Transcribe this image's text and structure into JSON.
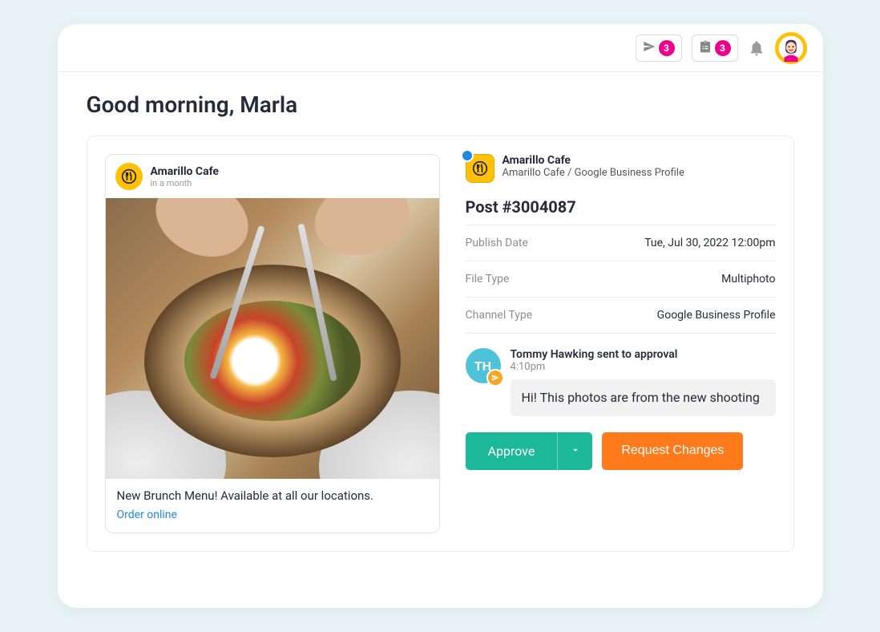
{
  "topbar": {
    "send_badge": "3",
    "clipboard_badge": "3"
  },
  "greeting": "Good morning, Marla",
  "preview": {
    "account": "Amarillo Cafe",
    "timing": "in a month",
    "caption": "New Brunch Menu! Available at all our locations.",
    "link": "Order online"
  },
  "details": {
    "account": "Amarillo Cafe",
    "breadcrumb": "Amarillo Cafe / Google Business Profile",
    "post_id": "Post #3004087",
    "rows": {
      "publish_date_label": "Publish Date",
      "publish_date_value": "Tue, Jul 30, 2022 12:00pm",
      "file_type_label": "File Type",
      "file_type_value": "Multiphoto",
      "channel_type_label": "Channel Type",
      "channel_type_value": "Google Business Profile"
    }
  },
  "activity": {
    "initials": "TH",
    "action": "Tommy Hawking sent to approval",
    "time": "4:10pm",
    "message": "Hi! This photos are from the new shooting"
  },
  "buttons": {
    "approve": "Approve",
    "request": "Request Changes"
  }
}
